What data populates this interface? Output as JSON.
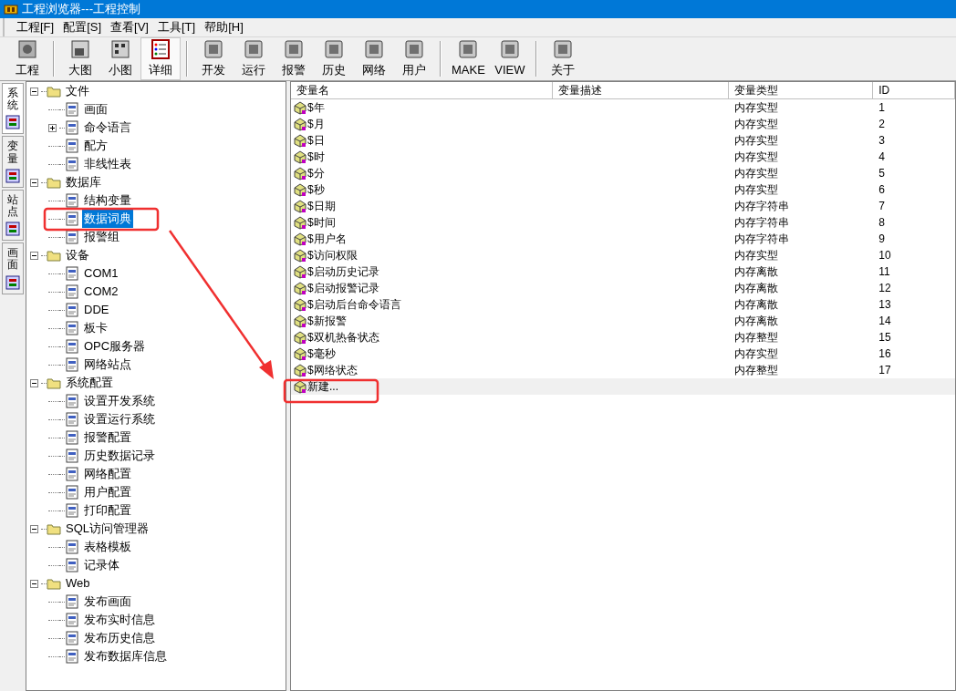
{
  "window": {
    "title": "工程浏览器---工程控制"
  },
  "menu": [
    "工程[F]",
    "配置[S]",
    "查看[V]",
    "工具[T]",
    "帮助[H]"
  ],
  "toolbar": {
    "groups": [
      {
        "buttons": [
          {
            "label": "工程",
            "selected": false
          }
        ]
      },
      {
        "buttons": [
          {
            "label": "大图",
            "selected": false
          },
          {
            "label": "小图",
            "selected": false
          },
          {
            "label": "详细",
            "selected": true
          }
        ]
      },
      {
        "buttons": [
          {
            "label": "开发",
            "selected": false
          },
          {
            "label": "运行",
            "selected": false
          },
          {
            "label": "报警",
            "selected": false
          },
          {
            "label": "历史",
            "selected": false
          },
          {
            "label": "网络",
            "selected": false
          },
          {
            "label": "用户",
            "selected": false
          }
        ]
      },
      {
        "buttons": [
          {
            "label": "MAKE",
            "selected": false
          },
          {
            "label": "VIEW",
            "selected": false
          }
        ]
      },
      {
        "buttons": [
          {
            "label": "关于",
            "selected": false
          }
        ]
      }
    ]
  },
  "side_tabs": [
    {
      "label": "系统",
      "selected": true
    },
    {
      "label": "变量",
      "selected": false
    },
    {
      "label": "站点",
      "selected": false
    },
    {
      "label": "画面",
      "selected": false
    }
  ],
  "tree": [
    {
      "label": "文件",
      "expanded": true,
      "selected": false,
      "children": [
        {
          "label": "画面",
          "selected": false
        },
        {
          "label": "命令语言",
          "expanded": false,
          "selected": false
        },
        {
          "label": "配方",
          "selected": false
        },
        {
          "label": "非线性表",
          "selected": false
        }
      ]
    },
    {
      "label": "数据库",
      "expanded": true,
      "selected": false,
      "children": [
        {
          "label": "结构变量",
          "selected": false
        },
        {
          "label": "数据词典",
          "selected": true
        },
        {
          "label": "报警组",
          "selected": false
        }
      ]
    },
    {
      "label": "设备",
      "expanded": true,
      "selected": false,
      "children": [
        {
          "label": "COM1",
          "selected": false
        },
        {
          "label": "COM2",
          "selected": false
        },
        {
          "label": "DDE",
          "selected": false
        },
        {
          "label": "板卡",
          "selected": false
        },
        {
          "label": "OPC服务器",
          "selected": false
        },
        {
          "label": "网络站点",
          "selected": false
        }
      ]
    },
    {
      "label": "系统配置",
      "expanded": true,
      "selected": false,
      "children": [
        {
          "label": "设置开发系统",
          "selected": false
        },
        {
          "label": "设置运行系统",
          "selected": false
        },
        {
          "label": "报警配置",
          "selected": false
        },
        {
          "label": "历史数据记录",
          "selected": false
        },
        {
          "label": "网络配置",
          "selected": false
        },
        {
          "label": "用户配置",
          "selected": false
        },
        {
          "label": "打印配置",
          "selected": false
        }
      ]
    },
    {
      "label": "SQL访问管理器",
      "expanded": true,
      "selected": false,
      "children": [
        {
          "label": "表格模板",
          "selected": false
        },
        {
          "label": "记录体",
          "selected": false
        }
      ]
    },
    {
      "label": "Web",
      "expanded": true,
      "selected": false,
      "children": [
        {
          "label": "发布画面",
          "selected": false
        },
        {
          "label": "发布实时信息",
          "selected": false
        },
        {
          "label": "发布历史信息",
          "selected": false
        },
        {
          "label": "发布数据库信息",
          "selected": false
        }
      ]
    }
  ],
  "table": {
    "columns": [
      "变量名",
      "变量描述",
      "变量类型",
      "ID"
    ],
    "rows": [
      {
        "name": "$年",
        "type": "内存实型",
        "id": "1",
        "selected": false
      },
      {
        "name": "$月",
        "type": "内存实型",
        "id": "2",
        "selected": false
      },
      {
        "name": "$日",
        "type": "内存实型",
        "id": "3",
        "selected": false
      },
      {
        "name": "$时",
        "type": "内存实型",
        "id": "4",
        "selected": false
      },
      {
        "name": "$分",
        "type": "内存实型",
        "id": "5",
        "selected": false
      },
      {
        "name": "$秒",
        "type": "内存实型",
        "id": "6",
        "selected": false
      },
      {
        "name": "$日期",
        "type": "内存字符串",
        "id": "7",
        "selected": false
      },
      {
        "name": "$时间",
        "type": "内存字符串",
        "id": "8",
        "selected": false
      },
      {
        "name": "$用户名",
        "type": "内存字符串",
        "id": "9",
        "selected": false
      },
      {
        "name": "$访问权限",
        "type": "内存实型",
        "id": "10",
        "selected": false
      },
      {
        "name": "$启动历史记录",
        "type": "内存离散",
        "id": "11",
        "selected": false
      },
      {
        "name": "$启动报警记录",
        "type": "内存离散",
        "id": "12",
        "selected": false
      },
      {
        "name": "$启动后台命令语言",
        "type": "内存离散",
        "id": "13",
        "selected": false
      },
      {
        "name": "$新报警",
        "type": "内存离散",
        "id": "14",
        "selected": false
      },
      {
        "name": "$双机热备状态",
        "type": "内存整型",
        "id": "15",
        "selected": false
      },
      {
        "name": "$毫秒",
        "type": "内存实型",
        "id": "16",
        "selected": false
      },
      {
        "name": "$网络状态",
        "type": "内存整型",
        "id": "17",
        "selected": false
      }
    ],
    "new_row": {
      "label": "新建...",
      "selected": true
    }
  }
}
